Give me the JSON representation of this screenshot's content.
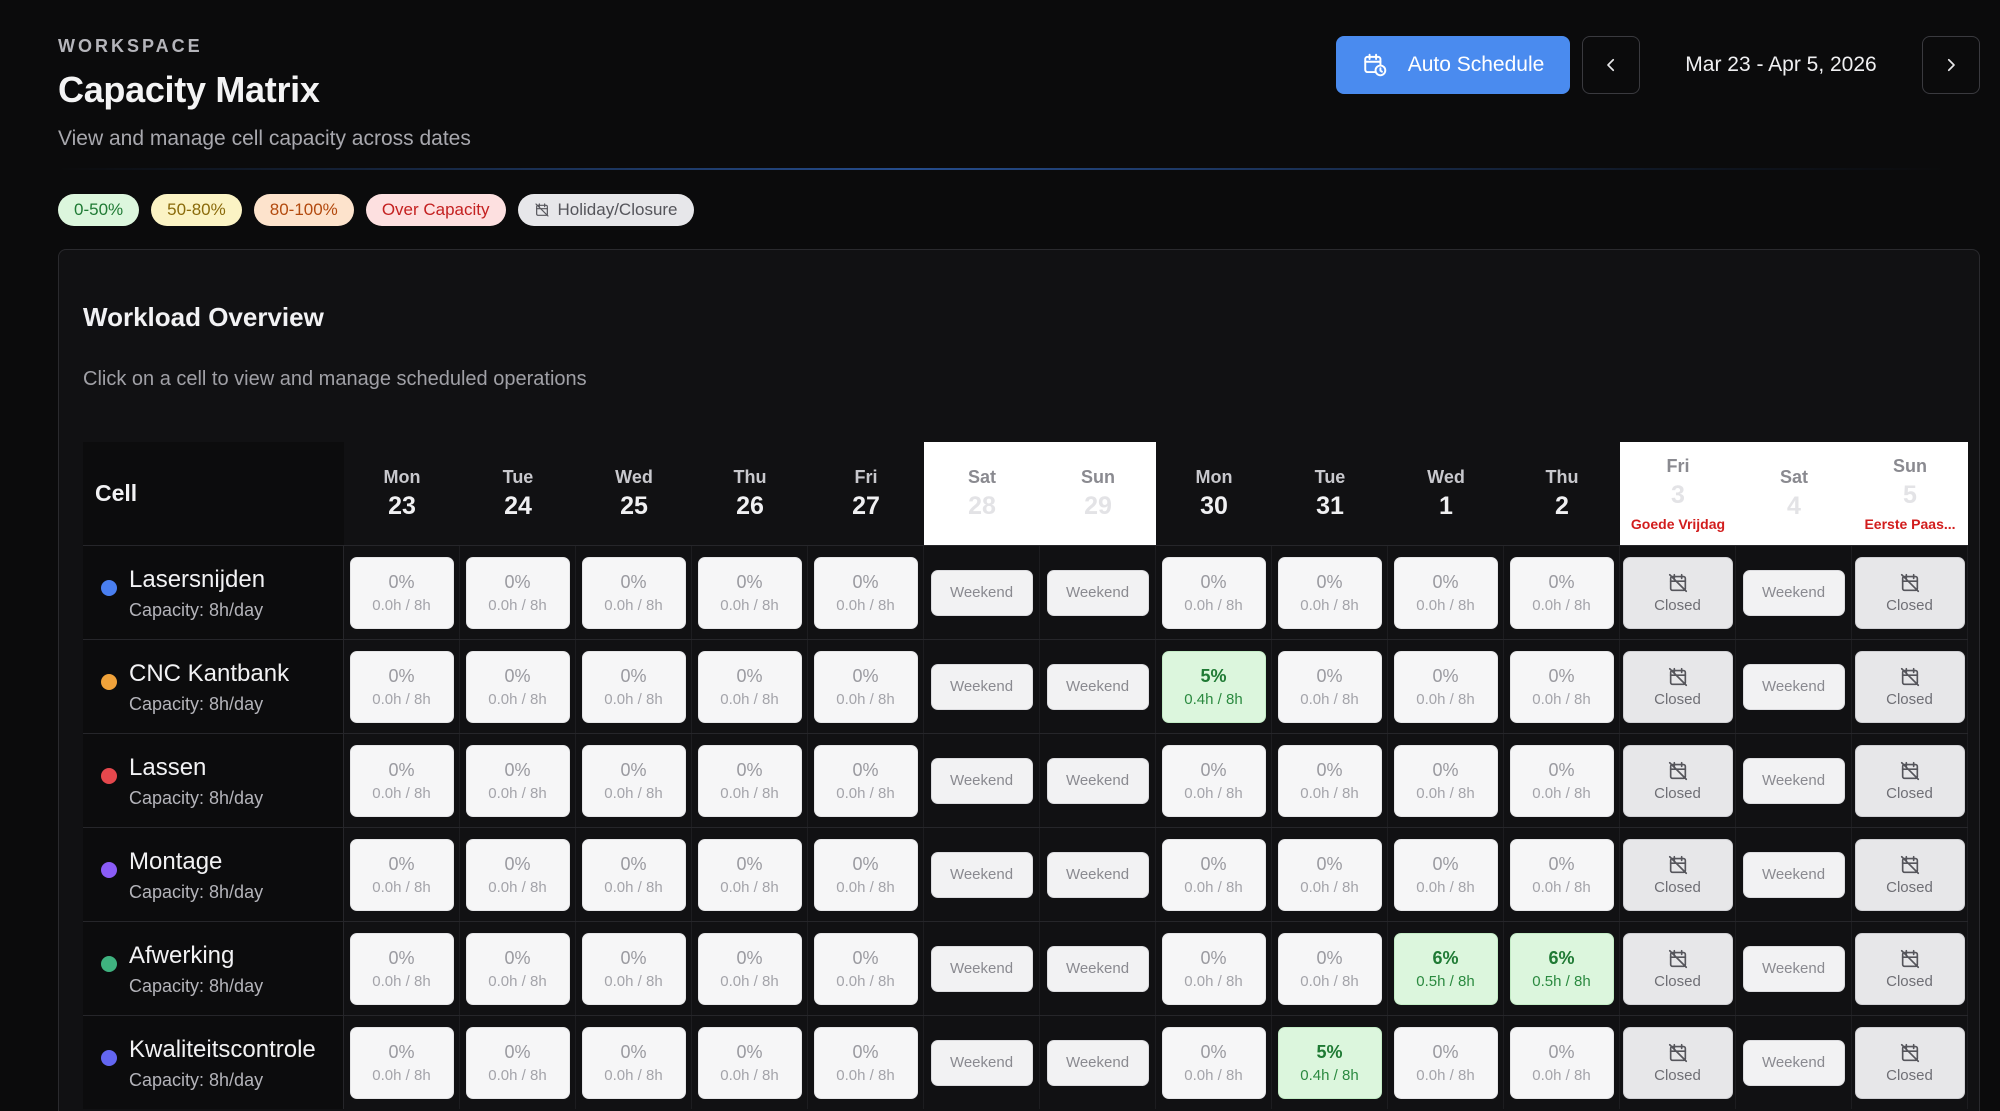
{
  "header": {
    "eyebrow": "WORKSPACE",
    "title": "Capacity Matrix",
    "subtitle": "View and manage cell capacity across dates"
  },
  "toolbar": {
    "auto_schedule_label": "Auto Schedule",
    "date_range": "Mar 23 - Apr 5, 2026"
  },
  "legend": [
    {
      "label": "0-50%",
      "bg": "#dcf6dd",
      "fg": "#1f7a34"
    },
    {
      "label": "50-80%",
      "bg": "#fbf3c4",
      "fg": "#8a6a0a"
    },
    {
      "label": "80-100%",
      "bg": "#fde3cc",
      "fg": "#b34a0e"
    },
    {
      "label": "Over Capacity",
      "bg": "#fde0e0",
      "fg": "#c42121"
    },
    {
      "label": "Holiday/Closure",
      "bg": "#e7e7ea",
      "fg": "#55555b",
      "icon": "calendar-off-icon"
    }
  ],
  "panel": {
    "title": "Workload Overview",
    "description": "Click on a cell to view and manage scheduled operations",
    "cell_header": "Cell"
  },
  "labels": {
    "weekend": "Weekend",
    "closed": "Closed"
  },
  "days": [
    {
      "name": "Mon",
      "num": "23",
      "type": "work"
    },
    {
      "name": "Tue",
      "num": "24",
      "type": "work"
    },
    {
      "name": "Wed",
      "num": "25",
      "type": "work"
    },
    {
      "name": "Thu",
      "num": "26",
      "type": "work"
    },
    {
      "name": "Fri",
      "num": "27",
      "type": "work"
    },
    {
      "name": "Sat",
      "num": "28",
      "type": "weekend"
    },
    {
      "name": "Sun",
      "num": "29",
      "type": "weekend"
    },
    {
      "name": "Mon",
      "num": "30",
      "type": "work"
    },
    {
      "name": "Tue",
      "num": "31",
      "type": "work"
    },
    {
      "name": "Wed",
      "num": "1",
      "type": "work"
    },
    {
      "name": "Thu",
      "num": "2",
      "type": "work"
    },
    {
      "name": "Fri",
      "num": "3",
      "type": "holiday",
      "holiday": "Goede Vrijdag"
    },
    {
      "name": "Sat",
      "num": "4",
      "type": "weekend"
    },
    {
      "name": "Sun",
      "num": "5",
      "type": "holiday",
      "holiday": "Eerste Paas..."
    }
  ],
  "cells": [
    {
      "name": "Lasersnijden",
      "capacity": "Capacity: 8h/day",
      "color": "#4a7ff0",
      "values": [
        [
          "0%",
          "0.0h / 8h"
        ],
        [
          "0%",
          "0.0h / 8h"
        ],
        [
          "0%",
          "0.0h / 8h"
        ],
        [
          "0%",
          "0.0h / 8h"
        ],
        [
          "0%",
          "0.0h / 8h"
        ],
        null,
        null,
        [
          "0%",
          "0.0h / 8h"
        ],
        [
          "0%",
          "0.0h / 8h"
        ],
        [
          "0%",
          "0.0h / 8h"
        ],
        [
          "0%",
          "0.0h / 8h"
        ],
        null,
        null,
        null
      ]
    },
    {
      "name": "CNC Kantbank",
      "capacity": "Capacity: 8h/day",
      "color": "#f0a23a",
      "values": [
        [
          "0%",
          "0.0h / 8h"
        ],
        [
          "0%",
          "0.0h / 8h"
        ],
        [
          "0%",
          "0.0h / 8h"
        ],
        [
          "0%",
          "0.0h / 8h"
        ],
        [
          "0%",
          "0.0h / 8h"
        ],
        null,
        null,
        [
          "5%",
          "0.4h / 8h"
        ],
        [
          "0%",
          "0.0h / 8h"
        ],
        [
          "0%",
          "0.0h / 8h"
        ],
        [
          "0%",
          "0.0h / 8h"
        ],
        null,
        null,
        null
      ]
    },
    {
      "name": "Lassen",
      "capacity": "Capacity: 8h/day",
      "color": "#e5484d",
      "values": [
        [
          "0%",
          "0.0h / 8h"
        ],
        [
          "0%",
          "0.0h / 8h"
        ],
        [
          "0%",
          "0.0h / 8h"
        ],
        [
          "0%",
          "0.0h / 8h"
        ],
        [
          "0%",
          "0.0h / 8h"
        ],
        null,
        null,
        [
          "0%",
          "0.0h / 8h"
        ],
        [
          "0%",
          "0.0h / 8h"
        ],
        [
          "0%",
          "0.0h / 8h"
        ],
        [
          "0%",
          "0.0h / 8h"
        ],
        null,
        null,
        null
      ]
    },
    {
      "name": "Montage",
      "capacity": "Capacity: 8h/day",
      "color": "#8b5cf6",
      "values": [
        [
          "0%",
          "0.0h / 8h"
        ],
        [
          "0%",
          "0.0h / 8h"
        ],
        [
          "0%",
          "0.0h / 8h"
        ],
        [
          "0%",
          "0.0h / 8h"
        ],
        [
          "0%",
          "0.0h / 8h"
        ],
        null,
        null,
        [
          "0%",
          "0.0h / 8h"
        ],
        [
          "0%",
          "0.0h / 8h"
        ],
        [
          "0%",
          "0.0h / 8h"
        ],
        [
          "0%",
          "0.0h / 8h"
        ],
        null,
        null,
        null
      ]
    },
    {
      "name": "Afwerking",
      "capacity": "Capacity: 8h/day",
      "color": "#3fb27f",
      "values": [
        [
          "0%",
          "0.0h / 8h"
        ],
        [
          "0%",
          "0.0h / 8h"
        ],
        [
          "0%",
          "0.0h / 8h"
        ],
        [
          "0%",
          "0.0h / 8h"
        ],
        [
          "0%",
          "0.0h / 8h"
        ],
        null,
        null,
        [
          "0%",
          "0.0h / 8h"
        ],
        [
          "0%",
          "0.0h / 8h"
        ],
        [
          "6%",
          "0.5h / 8h"
        ],
        [
          "6%",
          "0.5h / 8h"
        ],
        null,
        null,
        null
      ]
    },
    {
      "name": "Kwaliteitscontrole",
      "capacity": "Capacity: 8h/day",
      "color": "#6366f1",
      "values": [
        [
          "0%",
          "0.0h / 8h"
        ],
        [
          "0%",
          "0.0h / 8h"
        ],
        [
          "0%",
          "0.0h / 8h"
        ],
        [
          "0%",
          "0.0h / 8h"
        ],
        [
          "0%",
          "0.0h / 8h"
        ],
        null,
        null,
        [
          "0%",
          "0.0h / 8h"
        ],
        [
          "5%",
          "0.4h / 8h"
        ],
        [
          "0%",
          "0.0h / 8h"
        ],
        [
          "0%",
          "0.0h / 8h"
        ],
        null,
        null,
        null
      ]
    }
  ]
}
